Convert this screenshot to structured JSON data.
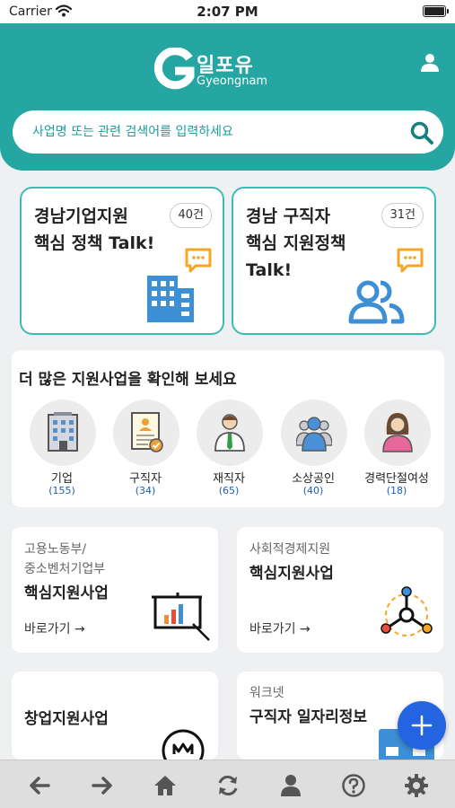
{
  "status_bar": {
    "carrier": "Carrier",
    "time": "2:07 PM"
  },
  "header": {
    "logo_korean": "일포유",
    "logo_english": "Gyeongnam",
    "search_placeholder": "사업명 또는 관련 검색어를 입력하세요"
  },
  "talk_cards": [
    {
      "title": "경남기업지원\n핵심 정책 Talk!",
      "count": "40건",
      "icon": "building-icon"
    },
    {
      "title": "경남 구직자\n핵심 지원정책\nTalk!",
      "count": "31건",
      "icon": "people-icon"
    }
  ],
  "more": {
    "heading": "더 많은 지원사업을 확인해 보세요",
    "categories": [
      {
        "label": "기업",
        "count": "(155)",
        "icon": "office-building-icon"
      },
      {
        "label": "구직자",
        "count": "(34)",
        "icon": "resume-icon"
      },
      {
        "label": "재직자",
        "count": "(65)",
        "icon": "employee-icon"
      },
      {
        "label": "소상공인",
        "count": "(40)",
        "icon": "small-business-icon"
      },
      {
        "label": "경력단절여성",
        "count": "(18)",
        "icon": "woman-icon"
      }
    ]
  },
  "programs": [
    {
      "sub": "고용노동부/\n중소벤처기업부",
      "title": "핵심지원사업",
      "go": "바로가기 →",
      "icon": "presentation-chart-icon"
    },
    {
      "sub": "사회적경제지원",
      "title": "핵심지원사업",
      "go": "바로가기 →",
      "icon": "network-icon"
    },
    {
      "sub": "",
      "title": "창업지원사업",
      "icon": "startup-icon"
    },
    {
      "sub": "워크넷",
      "title": "구직자 일자리정보",
      "icon": "job-info-icon"
    }
  ],
  "colors": {
    "teal": "#25a6a3",
    "card_border": "#3bbcb6",
    "fab": "#2464e0",
    "bubble": "#f5a623",
    "icon_blue": "#3d8fd6"
  },
  "toolbar": [
    "back-icon",
    "forward-icon",
    "home-icon",
    "refresh-icon",
    "profile-icon",
    "help-icon",
    "settings-icon"
  ]
}
